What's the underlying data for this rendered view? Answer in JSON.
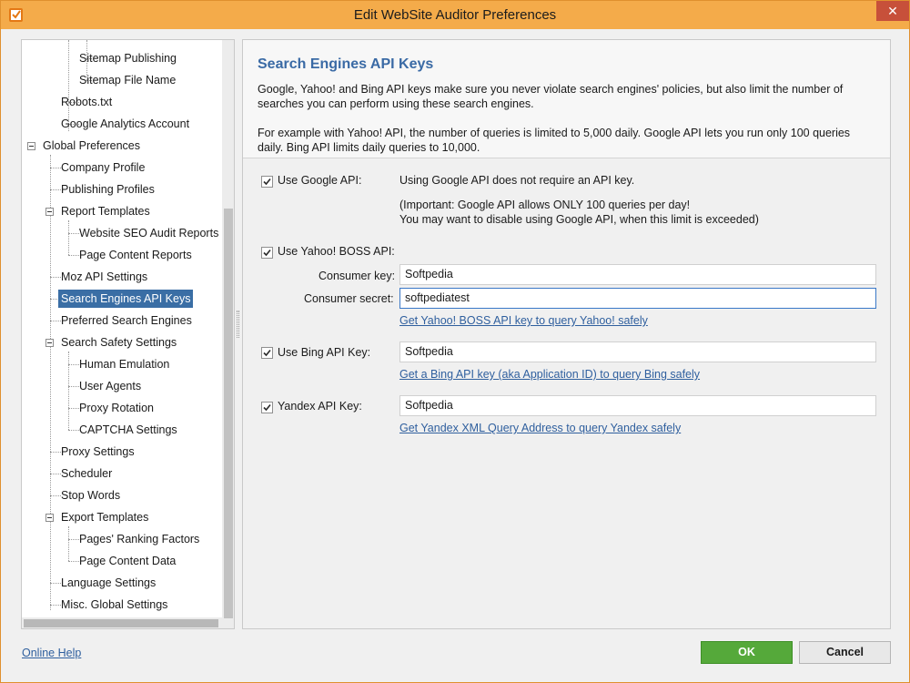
{
  "window": {
    "title": "Edit WebSite Auditor Preferences",
    "close_glyph": "✕"
  },
  "tree": {
    "items": [
      {
        "label": "Sitemap Publishing"
      },
      {
        "label": "Sitemap File Name"
      },
      {
        "label": "Robots.txt"
      },
      {
        "label": "Google Analytics Account"
      },
      {
        "label": "Global Preferences"
      },
      {
        "label": "Company Profile"
      },
      {
        "label": "Publishing Profiles"
      },
      {
        "label": "Report Templates"
      },
      {
        "label": "Website SEO Audit Reports"
      },
      {
        "label": "Page Content Reports"
      },
      {
        "label": "Moz API Settings"
      },
      {
        "label": "Search Engines API Keys"
      },
      {
        "label": "Preferred Search Engines"
      },
      {
        "label": "Search Safety Settings"
      },
      {
        "label": "Human Emulation"
      },
      {
        "label": "User Agents"
      },
      {
        "label": "Proxy Rotation"
      },
      {
        "label": "CAPTCHA Settings"
      },
      {
        "label": "Proxy Settings"
      },
      {
        "label": "Scheduler"
      },
      {
        "label": "Stop Words"
      },
      {
        "label": "Export Templates"
      },
      {
        "label": "Pages' Ranking Factors"
      },
      {
        "label": "Page Content Data"
      },
      {
        "label": "Language Settings"
      },
      {
        "label": "Misc. Global Settings"
      }
    ],
    "selected": "Search Engines API Keys"
  },
  "header": {
    "title": "Search Engines API Keys",
    "paragraph1": "Google, Yahoo! and Bing API keys make sure you never violate search engines' policies, but also limit the number of searches you can perform using these search engines.",
    "paragraph2": "For example with Yahoo! API, the number of queries is limited to 5,000 daily. Google API lets you run only 100 queries daily. Bing API limits daily queries to 10,000."
  },
  "google": {
    "checkbox_label": "Use Google API:",
    "checked": true,
    "note1": "Using Google API does not require an API key.",
    "note2": "(Important: Google API allows ONLY 100 queries per day!",
    "note3": "You may want to disable using Google API, when this limit is exceeded)"
  },
  "yahoo": {
    "checkbox_label": "Use Yahoo! BOSS API:",
    "checked": true,
    "consumer_key_label": "Consumer key:",
    "consumer_key_value": "Softpedia",
    "consumer_secret_label": "Consumer secret:",
    "consumer_secret_value": "softpediatest",
    "link": "Get Yahoo! BOSS API key to query Yahoo! safely"
  },
  "bing": {
    "checkbox_label": "Use Bing API Key:",
    "checked": true,
    "value": "Softpedia",
    "link": "Get a Bing API key (aka Application ID) to query Bing safely"
  },
  "yandex": {
    "checkbox_label": "Yandex API Key:",
    "checked": true,
    "value": "Softpedia",
    "link": "Get Yandex XML Query Address to query Yandex safely"
  },
  "footer": {
    "online_help": "Online Help",
    "ok_label": "OK",
    "cancel_label": "Cancel"
  },
  "colors": {
    "titlebar": "#f4ab4a",
    "accent_blue": "#3a6aa5",
    "ok_green": "#55a93a",
    "link_blue": "#2f5f9e",
    "selection": "#3a6ea5"
  }
}
